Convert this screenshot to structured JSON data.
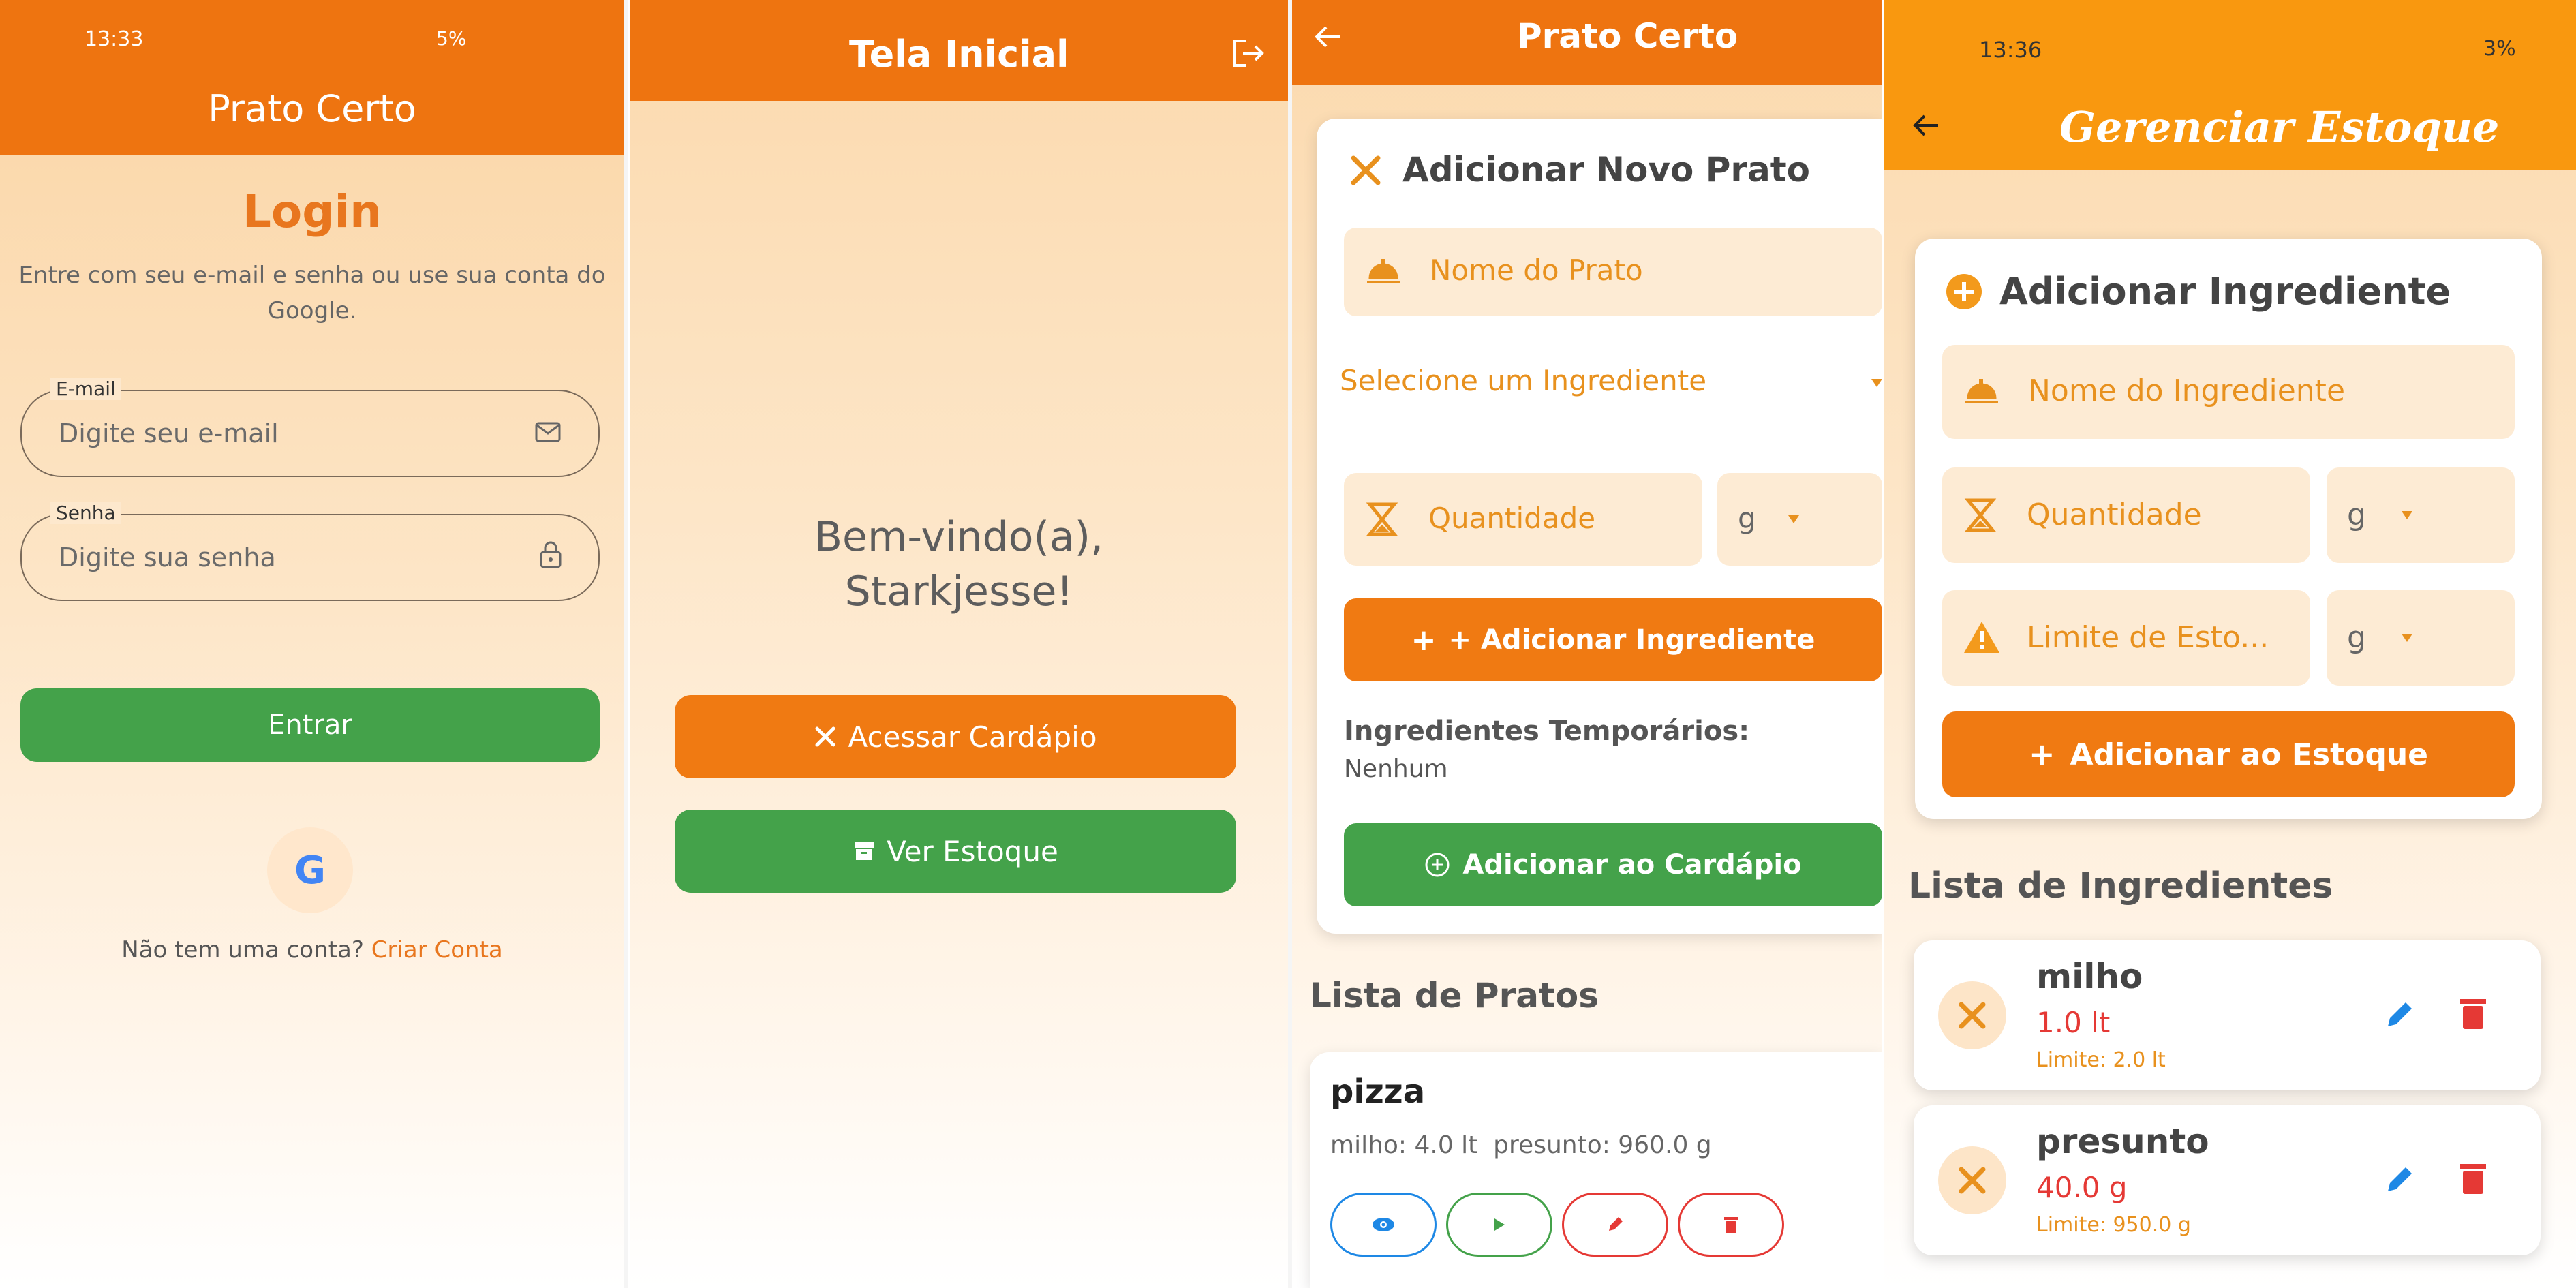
{
  "login_screen": {
    "status_time": "13:33",
    "status_right": "5%",
    "app_title": "Prato Certo",
    "heading": "Login",
    "subtitle": "Entre com seu e-mail e senha ou use sua conta do Google.",
    "email_label": "E-mail",
    "email_placeholder": "Digite seu e-mail",
    "password_label": "Senha",
    "password_placeholder": "Digite sua senha",
    "login_button": "Entrar",
    "google_letter": "G",
    "signup_prompt": "Não tem uma conta?",
    "signup_link": "Criar Conta"
  },
  "home_screen": {
    "title": "Tela Inicial",
    "welcome": "Bem-vindo(a),",
    "username": "Starkjesse!",
    "menu_button": "Acessar Cardápio",
    "stock_button": "Ver Estoque"
  },
  "menu_screen": {
    "title": "Prato Certo",
    "card_title": "Adicionar Novo Prato",
    "dish_name_placeholder": "Nome do Prato",
    "ingredient_select": "Selecione um Ingrediente",
    "quantity_placeholder": "Quantidade",
    "unit": "g",
    "add_ingredient_button": "+ Adicionar Ingrediente",
    "temp_label": "Ingredientes Temporários:",
    "temp_value": "Nenhum",
    "add_to_menu_button": "Adicionar ao Cardápio",
    "list_title": "Lista de Pratos",
    "dishes": [
      {
        "name": "pizza",
        "ingredients": "milho: 4.0 lt  presunto: 960.0 g"
      }
    ]
  },
  "stock_screen": {
    "status_time": "13:36",
    "status_right": "3%",
    "title": "Gerenciar Estoque",
    "card_title": "Adicionar Ingrediente",
    "name_placeholder": "Nome do Ingrediente",
    "quantity_placeholder": "Quantidade",
    "limit_placeholder": "Limite de Esto...",
    "unit": "g",
    "add_button": "Adicionar ao Estoque",
    "list_title": "Lista de Ingredientes",
    "ingredients": [
      {
        "name": "milho",
        "quantity": "1.0 lt",
        "limit": "Limite: 2.0 lt"
      },
      {
        "name": "presunto",
        "quantity": "40.0 g",
        "limit": "Limite: 950.0 g"
      }
    ]
  },
  "colors": {
    "primary_orange": "#ee7410",
    "accent_orange": "#f9980f",
    "green": "#44a24a",
    "danger_red": "#e53935",
    "edit_blue": "#1e88e5"
  }
}
